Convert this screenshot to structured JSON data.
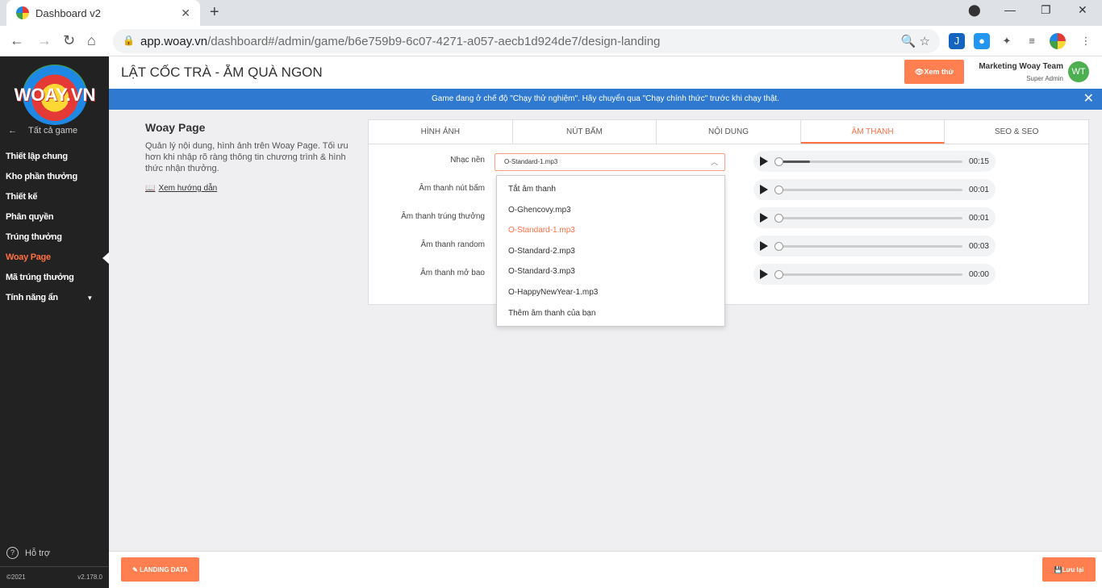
{
  "browser": {
    "tab_title": "Dashboard v2",
    "url_host": "app.woay.vn",
    "url_path": "/dashboard#/admin/game/b6e759b9-6c07-4271-a057-aecb1d924de7/design-landing"
  },
  "sidebar": {
    "logo_text": "WOAY.VN",
    "back_label": "Tất cả game",
    "items": [
      {
        "label": "Thiết lập chung"
      },
      {
        "label": "Kho phần thưởng"
      },
      {
        "label": "Thiết kế"
      },
      {
        "label": "Phân quyền"
      },
      {
        "label": "Trúng thưởng"
      },
      {
        "label": "Woay Page"
      },
      {
        "label": "Mã trúng thưởng"
      },
      {
        "label": "Tính năng ẩn"
      }
    ],
    "support_label": "Hỗ trợ",
    "copyright": "©2021",
    "version": "v2.178.0"
  },
  "header": {
    "title": "LẬT CỐC TRÀ - ẴM QUÀ NGON",
    "preview_label": "Xem thử",
    "user_name": "Marketing Woay Team",
    "user_role": "Super Admin",
    "avatar_initials": "WT"
  },
  "banner": {
    "text": "Game đang ở chế độ \"Chạy thử nghiệm\". Hãy chuyển qua \"Chạy chính thức\" trước khi chạy thật."
  },
  "intro": {
    "title": "Woay Page",
    "description": "Quản lý nội dung, hình ảnh trên Woay Page. Tối ưu hơn khi nhập rõ ràng thông tin chương trình & hình thức nhận thưởng.",
    "guide_label": "Xem hướng dẫn"
  },
  "tabs": [
    {
      "label": "HÌNH ẢNH"
    },
    {
      "label": "NÚT BẤM"
    },
    {
      "label": "NỘI DUNG"
    },
    {
      "label": "ÂM THANH"
    },
    {
      "label": "SEO & SEO"
    }
  ],
  "sound_rows": [
    {
      "label": "Nhạc nền",
      "time": "00:15"
    },
    {
      "label": "Âm thanh nút bấm",
      "time": "00:01"
    },
    {
      "label": "Âm thanh trúng thưởng",
      "time": "00:01"
    },
    {
      "label": "Âm thanh random",
      "time": "00:03"
    },
    {
      "label": "Âm thanh mở bao",
      "time": "00:00"
    }
  ],
  "select": {
    "value": "O-Standard-1.mp3"
  },
  "dropdown_options": [
    {
      "label": "Tắt âm thanh"
    },
    {
      "label": "O-Ghencovy.mp3"
    },
    {
      "label": "O-Standard-1.mp3"
    },
    {
      "label": "O-Standard-2.mp3"
    },
    {
      "label": "O-Standard-3.mp3"
    },
    {
      "label": "O-HappyNewYear-1.mp3"
    },
    {
      "label": "Thêm âm thanh của bạn"
    }
  ],
  "footer": {
    "landing_label": "LANDING DATA",
    "save_label": "Lưu lại"
  },
  "colors": {
    "accent": "#ff7f50",
    "banner": "#2f7ad0",
    "sidebar": "#222222"
  }
}
